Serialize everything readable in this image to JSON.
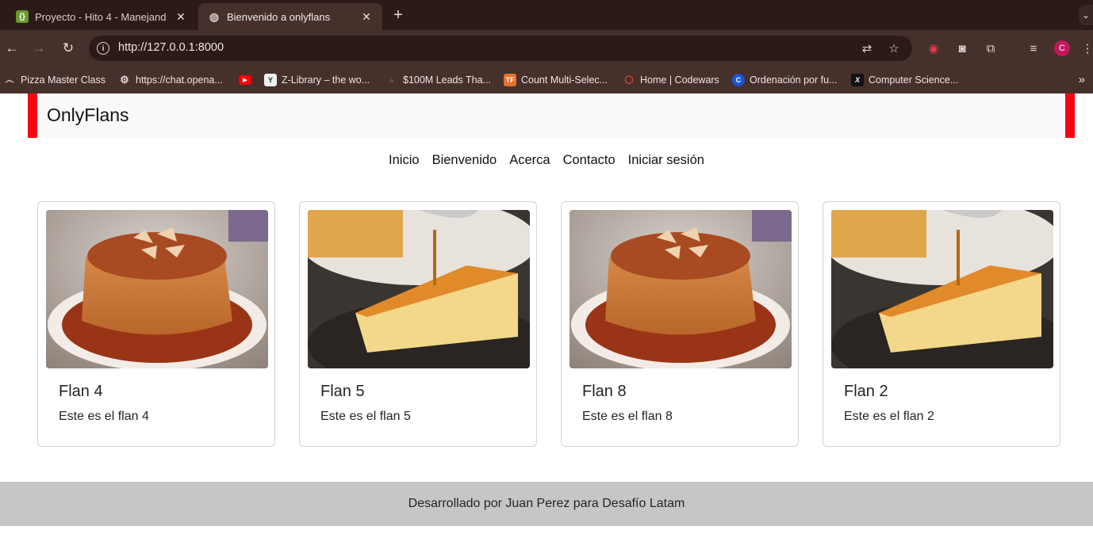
{
  "browser": {
    "tabs": [
      {
        "title": "Proyecto - Hito 4 - Manejand",
        "favicon": "code-brackets-icon"
      },
      {
        "title": "Bienvenido a onlyflans",
        "favicon": "globe-icon"
      }
    ],
    "url": "http://127.0.0.1:8000",
    "avatar_letter": "C",
    "bookmarks": [
      {
        "label": "Pizza Master Class",
        "icon": "mustache-icon"
      },
      {
        "label": "https://chat.opena...",
        "icon": "openai-icon"
      },
      {
        "label": "",
        "icon": "youtube-icon"
      },
      {
        "label": "Z-Library – the wo...",
        "icon": "zlibrary-icon"
      },
      {
        "label": "$100M Leads Tha...",
        "icon": "triangle-icon"
      },
      {
        "label": "Count Multi-Selec...",
        "icon": "tf-icon"
      },
      {
        "label": "Home | Codewars",
        "icon": "codewars-icon"
      },
      {
        "label": "Ordenación por fu...",
        "icon": "c-icon"
      },
      {
        "label": "Computer Science...",
        "icon": "x-icon"
      }
    ]
  },
  "site": {
    "brand": "OnlyFlans",
    "nav": [
      "Inicio",
      "Bienvenido",
      "Acerca",
      "Contacto",
      "Iniciar sesión"
    ],
    "cards": [
      {
        "title": "Flan 4",
        "text": "Este es el flan 4",
        "image": "round-flan-photo"
      },
      {
        "title": "Flan 5",
        "text": "Este es el flan 5",
        "image": "flan-slice-photo"
      },
      {
        "title": "Flan 8",
        "text": "Este es el flan 8",
        "image": "round-flan-photo"
      },
      {
        "title": "Flan 2",
        "text": "Este es el flan 2",
        "image": "flan-slice-photo"
      }
    ],
    "footer": "Desarrollado por Juan Perez para Desafío Latam"
  },
  "colors": {
    "accent_red": "#ff0014",
    "chrome_dark": "#2b1a17",
    "chrome_mid": "#46302b",
    "footer_gray": "#c6c6c6"
  }
}
